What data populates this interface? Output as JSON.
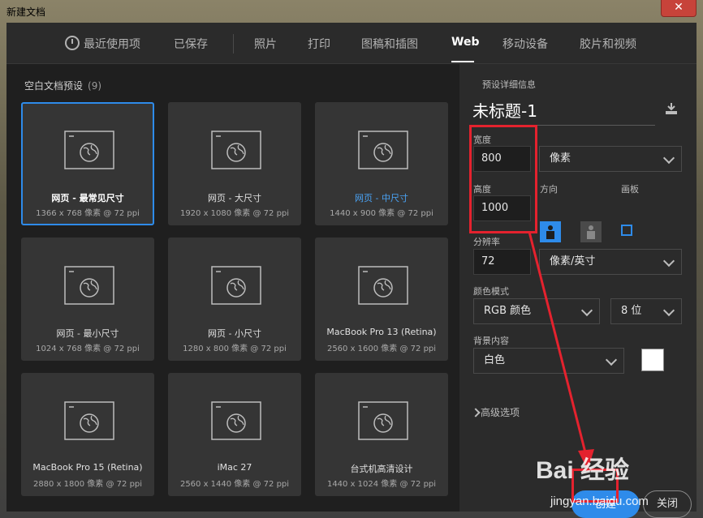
{
  "window": {
    "title": "新建文档",
    "close_glyph": "✕"
  },
  "tabs": [
    {
      "label": "最近使用项",
      "icon": "clock-icon"
    },
    {
      "label": "已保存"
    },
    {
      "label": "照片"
    },
    {
      "label": "打印"
    },
    {
      "label": "图稿和插图"
    },
    {
      "label": "Web",
      "active": true
    },
    {
      "label": "移动设备"
    },
    {
      "label": "胶片和视频"
    }
  ],
  "presets": {
    "title": "空白文档预设",
    "count": "(9)",
    "items": [
      {
        "name": "网页 - 最常见尺寸",
        "size": "1366 x 768 像素 @ 72 ppi",
        "selected": true
      },
      {
        "name": "网页 - 大尺寸",
        "size": "1920 x 1080 像素 @ 72 ppi"
      },
      {
        "name": "网页 - 中尺寸",
        "size": "1440 x 900 像素 @ 72 ppi",
        "highlight": true
      },
      {
        "name": "网页 - 最小尺寸",
        "size": "1024 x 768 像素 @ 72 ppi"
      },
      {
        "name": "网页 - 小尺寸",
        "size": "1280 x 800 像素 @ 72 ppi"
      },
      {
        "name": "MacBook Pro 13 (Retina)",
        "size": "2560 x 1600 像素 @ 72 ppi"
      },
      {
        "name": "MacBook Pro 15 (Retina)",
        "size": "2880 x 1800 像素 @ 72 ppi"
      },
      {
        "name": "iMac 27",
        "size": "2560 x 1440 像素 @ 72 ppi"
      },
      {
        "name": "台式机高清设计",
        "size": "1440 x 1024 像素 @ 72 ppi"
      }
    ]
  },
  "details": {
    "header": "预设详细信息",
    "doc_name": "未标题-1",
    "width_label": "宽度",
    "width_value": "800",
    "unit": "像素",
    "height_label": "高度",
    "height_value": "1000",
    "orientation_label": "方向",
    "artboard_label": "画板",
    "resolution_label": "分辨率",
    "resolution_value": "72",
    "resolution_unit": "像素/英寸",
    "color_mode_label": "颜色模式",
    "color_mode": "RGB 颜色",
    "bit_depth": "8 位",
    "background_label": "背景内容",
    "background": "白色",
    "advanced": "高级选项"
  },
  "buttons": {
    "create": "创建",
    "close": "关闭"
  },
  "watermark": {
    "brand": "Bai 经验",
    "url": "jingyan.baidu.com"
  },
  "colors": {
    "accent": "#2e8bea",
    "annotation": "#e4222e"
  }
}
